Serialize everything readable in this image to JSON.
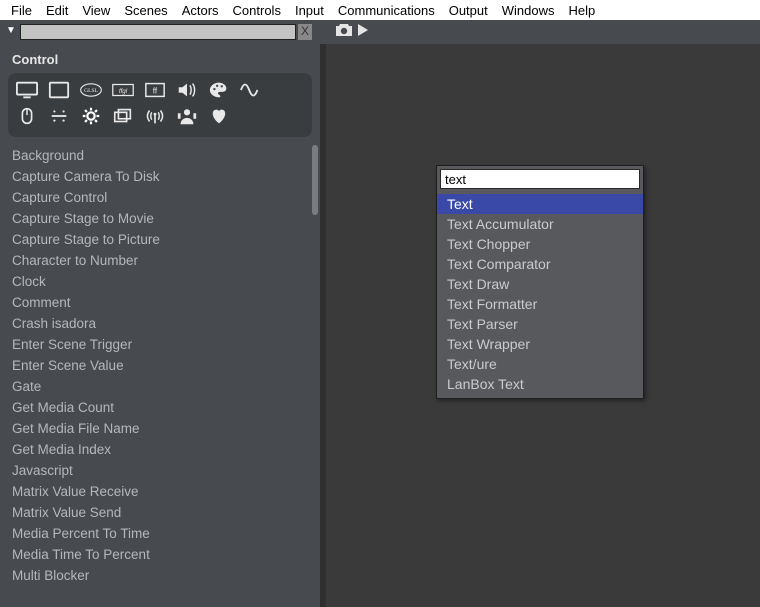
{
  "menubar": {
    "items": [
      "File",
      "Edit",
      "View",
      "Scenes",
      "Actors",
      "Controls",
      "Input",
      "Communications",
      "Output",
      "Windows",
      "Help"
    ]
  },
  "toolbar": {
    "search_value": "",
    "clear_label": "X"
  },
  "sidebar": {
    "title": "Control",
    "items": [
      "Background",
      "Capture Camera To Disk",
      "Capture Control",
      "Capture Stage to Movie",
      "Capture Stage to Picture",
      "Character to Number",
      "Clock",
      "Comment",
      "Crash isadora",
      "Enter Scene Trigger",
      "Enter Scene Value",
      "Gate",
      "Get Media Count",
      "Get Media File Name",
      "Get Media Index",
      "Javascript",
      "Matrix Value Receive",
      "Matrix Value Send",
      "Media Percent To Time",
      "Media Time To Percent",
      "Multi Blocker"
    ]
  },
  "popup": {
    "input_value": "text",
    "items": [
      "Text",
      "Text Accumulator",
      "Text Chopper",
      "Text Comparator",
      "Text Draw",
      "Text Formatter",
      "Text Parser",
      "Text Wrapper",
      "Text/ure",
      "LanBox Text"
    ],
    "selected_index": 0
  }
}
